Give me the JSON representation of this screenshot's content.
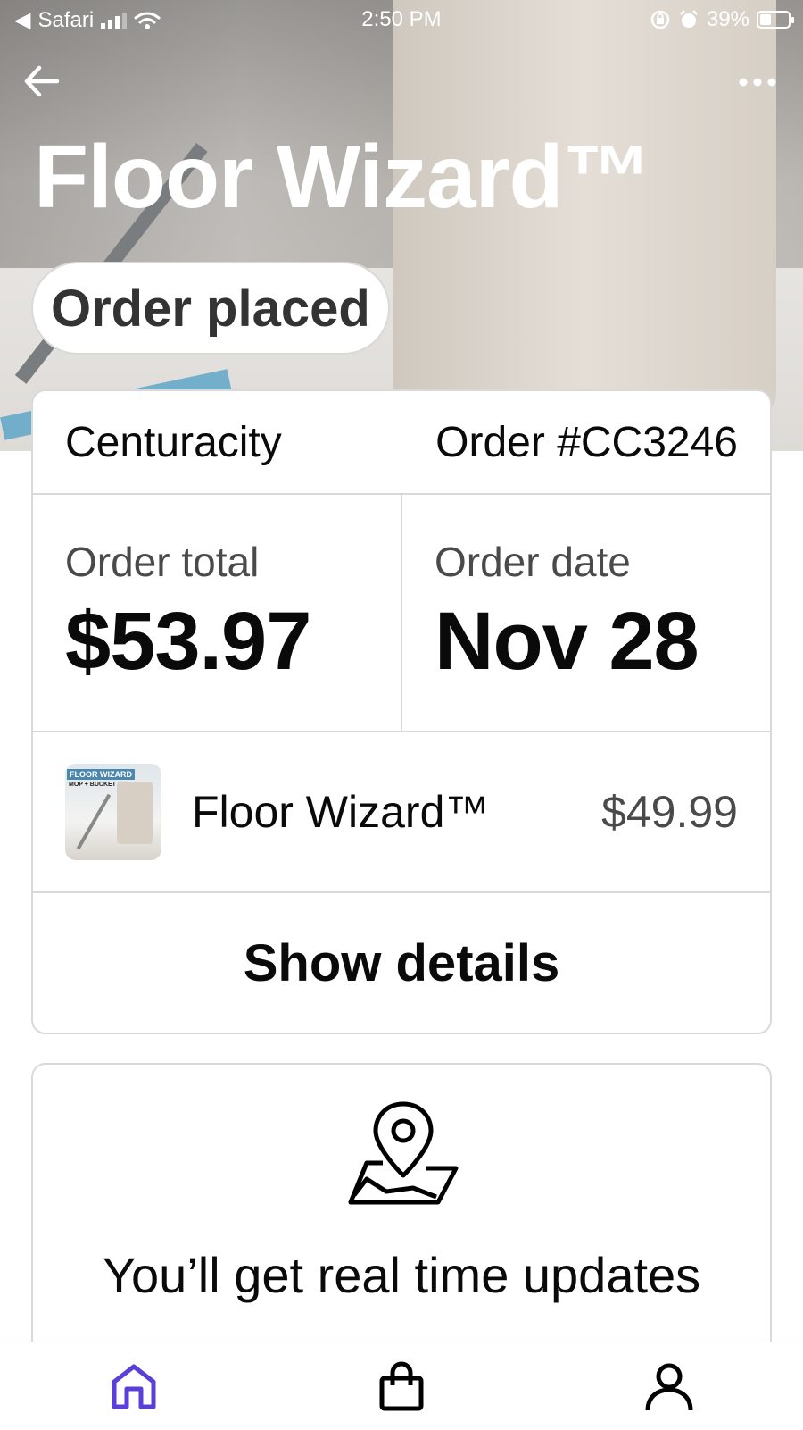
{
  "status_bar": {
    "carrier": "Safari",
    "time": "2:50 PM",
    "battery": "39%"
  },
  "header": {
    "title": "Floor Wizard™",
    "status": "Order placed"
  },
  "order": {
    "store": "Centuracity",
    "number": "Order #CC3246",
    "total_label": "Order total",
    "total_value": "$53.97",
    "date_label": "Order date",
    "date_value": "Nov 28",
    "item": {
      "thumb_line1": "FLOOR WIZARD",
      "thumb_line2": "MOP + BUCKET",
      "name": "Floor Wizard™",
      "price": "$49.99"
    },
    "details_label": "Show details"
  },
  "tracking": {
    "text": "You’ll get real time updates"
  },
  "tabs": [
    {
      "name": "home",
      "active": true
    },
    {
      "name": "shop",
      "active": false
    },
    {
      "name": "profile",
      "active": false
    }
  ],
  "colors": {
    "accent": "#5b3fd9",
    "border": "#d9d9d9",
    "text": "#0a0a0a",
    "muted": "#4a4a4a"
  }
}
